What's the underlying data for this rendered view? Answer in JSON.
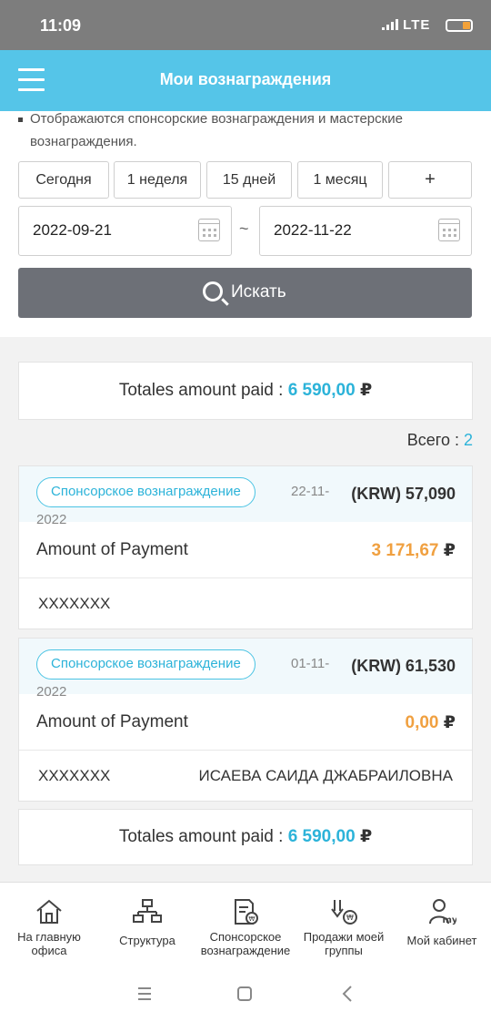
{
  "status_bar": {
    "time": "11:09",
    "network": "LTE"
  },
  "app_bar": {
    "title": "Мои вознаграждения"
  },
  "notice": {
    "line1": "Отображаются спонсорские вознаграждения и мастерские",
    "line2": "вознаграждения."
  },
  "periods": [
    {
      "label": "Сегодня"
    },
    {
      "label": "1 неделя"
    },
    {
      "label": "15 дней"
    },
    {
      "label": "1 месяц"
    },
    {
      "label": "+"
    }
  ],
  "date_range": {
    "from": "2022-09-21",
    "separator": "~",
    "to": "2022-11-22"
  },
  "search_button": {
    "label": "Искать"
  },
  "totals_top": {
    "label": "Totales amount paid : ",
    "amount": "6 590,00",
    "currency": "₽"
  },
  "count": {
    "label": "Всего : ",
    "value": "2"
  },
  "rewards": [
    {
      "type": "Спонсорское вознаграждение",
      "date_part1": "22-11-",
      "date_part2": "2022",
      "krw": "(KRW) 57,090",
      "payment_label": "Amount of Payment",
      "payment_amount": "3 171,67",
      "currency": "₽",
      "code": "XXXXXXX",
      "name": ""
    },
    {
      "type": "Спонсорское вознаграждение",
      "date_part1": "01-11-",
      "date_part2": "2022",
      "krw": "(KRW) 61,530",
      "payment_label": "Amount of Payment",
      "payment_amount": "0,00",
      "currency": "₽",
      "code": "XXXXXXX",
      "name": "ИСАЕВА САИДА ДЖАБРАИЛОВНА"
    }
  ],
  "totals_bottom": {
    "label": "Totales amount paid : ",
    "amount": "6 590,00",
    "currency": "₽"
  },
  "bottom_nav": [
    {
      "label": "На главную офиса",
      "icon": "home-icon"
    },
    {
      "label": "Структура",
      "icon": "structure-icon"
    },
    {
      "label": "Спонсорское вознаграждение",
      "icon": "sponsor-reward-icon"
    },
    {
      "label": "Продажи моей группы",
      "icon": "group-sales-icon"
    },
    {
      "label": "Мой кабинет",
      "icon": "my-cabinet-icon"
    }
  ],
  "colors": {
    "accent": "#2cb3d9",
    "appbar": "#55c5e8",
    "payment": "#f0a040",
    "search_button": "#6d7077"
  }
}
